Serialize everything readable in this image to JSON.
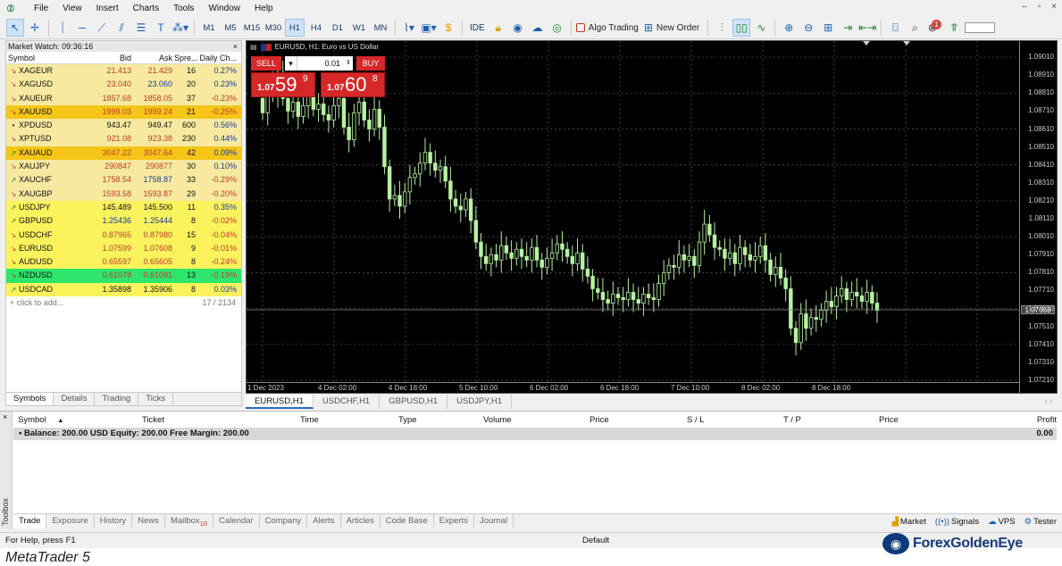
{
  "menu": {
    "items": [
      "File",
      "View",
      "Insert",
      "Charts",
      "Tools",
      "Window",
      "Help"
    ]
  },
  "toolbar": {
    "timeframes": [
      "M1",
      "M5",
      "M15",
      "M30",
      "H1",
      "H4",
      "D1",
      "W1",
      "MN"
    ],
    "active_timeframe": "H1",
    "ide_label": "IDE",
    "algo_label": "Algo Trading",
    "new_order_label": "New Order",
    "notification_count": "1"
  },
  "market_watch": {
    "title": "Market Watch: 09:36:16",
    "headers": {
      "symbol": "Symbol",
      "bid": "Bid",
      "ask": "Ask",
      "spread": "Spre...",
      "change": "Daily Ch..."
    },
    "rows": [
      {
        "symbol": "XAGEUR",
        "bid": "21.413",
        "ask": "21.429",
        "spread": "16",
        "change": "0.27%",
        "dir": "down",
        "bg": "#f7eaa0",
        "bidc": "#c0392b",
        "askc": "#c0392b",
        "chgc": "#1a3a9a"
      },
      {
        "symbol": "XAGUSD",
        "bid": "23.040",
        "ask": "23.060",
        "spread": "20",
        "change": "0.23%",
        "dir": "down",
        "bg": "#f7eaa0",
        "bidc": "#c0392b",
        "askc": "#1a3a9a",
        "chgc": "#1a3a9a"
      },
      {
        "symbol": "XAUEUR",
        "bid": "1857.68",
        "ask": "1858.05",
        "spread": "37",
        "change": "-0.23%",
        "dir": "down",
        "bg": "#f7eaa0",
        "bidc": "#c0392b",
        "askc": "#c0392b",
        "chgc": "#c0392b"
      },
      {
        "symbol": "XAUUSD",
        "bid": "1999.03",
        "ask": "1999.24",
        "spread": "21",
        "change": "-0.25%",
        "dir": "down",
        "bg": "#f5c518",
        "bidc": "#c0392b",
        "askc": "#c0392b",
        "chgc": "#c0392b"
      },
      {
        "symbol": "XPDUSD",
        "bid": "943.47",
        "ask": "949.47",
        "spread": "600",
        "change": "0.56%",
        "dir": "none",
        "bg": "#f7eaa0",
        "bidc": "#111111",
        "askc": "#111111",
        "chgc": "#1a3a9a"
      },
      {
        "symbol": "XPTUSD",
        "bid": "921.08",
        "ask": "923.38",
        "spread": "230",
        "change": "0.44%",
        "dir": "down",
        "bg": "#f7eaa0",
        "bidc": "#c0392b",
        "askc": "#c0392b",
        "chgc": "#1a3a9a"
      },
      {
        "symbol": "XAUAUD",
        "bid": "3047.22",
        "ask": "3047.64",
        "spread": "42",
        "change": "0.09%",
        "dir": "up",
        "bg": "#f5c518",
        "bidc": "#c0392b",
        "askc": "#c0392b",
        "chgc": "#1a3a9a"
      },
      {
        "symbol": "XAUJPY",
        "bid": "290847",
        "ask": "290877",
        "spread": "30",
        "change": "0.10%",
        "dir": "down",
        "bg": "#f7eaa0",
        "bidc": "#c0392b",
        "askc": "#c0392b",
        "chgc": "#1a3a9a"
      },
      {
        "symbol": "XAUCHF",
        "bid": "1758.54",
        "ask": "1758.87",
        "spread": "33",
        "change": "-0.29%",
        "dir": "up",
        "bg": "#f7eaa0",
        "bidc": "#c0392b",
        "askc": "#1a3a9a",
        "chgc": "#c0392b"
      },
      {
        "symbol": "XAUGBP",
        "bid": "1593.58",
        "ask": "1593.87",
        "spread": "29",
        "change": "-0.20%",
        "dir": "down",
        "bg": "#f7eaa0",
        "bidc": "#c0392b",
        "askc": "#c0392b",
        "chgc": "#c0392b"
      },
      {
        "symbol": "USDJPY",
        "bid": "145.489",
        "ask": "145.500",
        "spread": "11",
        "change": "0.35%",
        "dir": "up",
        "bg": "#fbf35c",
        "bidc": "#111111",
        "askc": "#111111",
        "chgc": "#1a3a9a"
      },
      {
        "symbol": "GBPUSD",
        "bid": "1.25436",
        "ask": "1.25444",
        "spread": "8",
        "change": "-0.02%",
        "dir": "up",
        "bg": "#fbf35c",
        "bidc": "#1a3a9a",
        "askc": "#1a3a9a",
        "chgc": "#c0392b"
      },
      {
        "symbol": "USDCHF",
        "bid": "0.87965",
        "ask": "0.87980",
        "spread": "15",
        "change": "-0.04%",
        "dir": "down",
        "bg": "#fbf35c",
        "bidc": "#c0392b",
        "askc": "#c0392b",
        "chgc": "#c0392b"
      },
      {
        "symbol": "EURUSD",
        "bid": "1.07599",
        "ask": "1.07608",
        "spread": "9",
        "change": "-0.01%",
        "dir": "down",
        "bg": "#fbf35c",
        "bidc": "#c0392b",
        "askc": "#c0392b",
        "chgc": "#c0392b"
      },
      {
        "symbol": "AUDUSD",
        "bid": "0.65597",
        "ask": "0.65605",
        "spread": "8",
        "change": "-0.24%",
        "dir": "down",
        "bg": "#fbf35c",
        "bidc": "#c0392b",
        "askc": "#c0392b",
        "chgc": "#c0392b"
      },
      {
        "symbol": "NZDUSD",
        "bid": "0.61078",
        "ask": "0.61091",
        "spread": "13",
        "change": "-0.19%",
        "dir": "down",
        "bg": "#2ee66b",
        "bidc": "#c0392b",
        "askc": "#c0392b",
        "chgc": "#c0392b"
      },
      {
        "symbol": "USDCAD",
        "bid": "1.35898",
        "ask": "1.35906",
        "spread": "8",
        "change": "0.03%",
        "dir": "up",
        "bg": "#fbf35c",
        "bidc": "#111111",
        "askc": "#111111",
        "chgc": "#1a3a9a"
      }
    ],
    "add_label": "click to add...",
    "count": "17 / 2134",
    "tabs": [
      "Symbols",
      "Details",
      "Trading",
      "Ticks"
    ]
  },
  "chart": {
    "title": "EURUSD, H1:  Euro vs US Dollar",
    "sell_label": "SELL",
    "buy_label": "BUY",
    "lot": "0.01",
    "sell_small": "1.07",
    "sell_big": "59",
    "sell_sup": "9",
    "buy_small": "1.07",
    "buy_big": "60",
    "buy_sup": "8",
    "current_price": "1.07603",
    "price_labels": [
      "1.09010",
      "1.08810",
      "1.08610",
      "1.08410",
      "1.08210",
      "1.08010",
      "1.07810",
      "1.07610",
      "1.07410",
      "1.07210"
    ],
    "price_labels_odd": [
      "1.08910",
      "1.08710",
      "1.08510",
      "1.08310",
      "1.08110",
      "1.07910",
      "1.07710",
      "1.07510",
      "1.07310"
    ],
    "time_labels": [
      "1 Dec 2023",
      "4 Dec 02:00",
      "4 Dec 18:00",
      "5 Dec 10:00",
      "6 Dec 02:00",
      "6 Dec 18:00",
      "7 Dec 10:00",
      "8 Dec 02:00",
      "8 Dec 18:00"
    ],
    "tabs": [
      "EURUSD,H1",
      "USDCHF,H1",
      "GBPUSD,H1",
      "USDJPY,H1"
    ]
  },
  "chart_data": {
    "type": "candlestick",
    "symbol": "EURUSD",
    "timeframe": "H1",
    "ylim": [
      1.0722,
      1.0908
    ],
    "close_series": [
      1.087,
      1.0885,
      1.088,
      1.0892,
      1.0878,
      1.0871,
      1.0876,
      1.0868,
      1.0874,
      1.088,
      1.0872,
      1.0875,
      1.0869,
      1.0866,
      1.0874,
      1.0878,
      1.0862,
      1.0855,
      1.087,
      1.0876,
      1.0866,
      1.0861,
      1.0872,
      1.0862,
      1.084,
      1.0822,
      1.0824,
      1.0818,
      1.0826,
      1.0834,
      1.0836,
      1.0842,
      1.0848,
      1.0842,
      1.0838,
      1.084,
      1.0832,
      1.0822,
      1.0818,
      1.0816,
      1.0822,
      1.081,
      1.0798,
      1.079,
      1.0786,
      1.0791,
      1.0788,
      1.0796,
      1.0792,
      1.0789,
      1.0794,
      1.079,
      1.0788,
      1.0795,
      1.0788,
      1.0784,
      1.0789,
      1.0792,
      1.0797,
      1.0794,
      1.079,
      1.0786,
      1.0792,
      1.0783,
      1.0779,
      1.0772,
      1.077,
      1.0766,
      1.0764,
      1.0769,
      1.0767,
      1.0766,
      1.077,
      1.0766,
      1.0764,
      1.0769,
      1.0767,
      1.0766,
      1.0775,
      1.0781,
      1.0785,
      1.0784,
      1.0791,
      1.0788,
      1.079,
      1.0785,
      1.0798,
      1.0808,
      1.0802,
      1.0795,
      1.0794,
      1.0789,
      1.0792,
      1.0786,
      1.0795,
      1.0791,
      1.0788,
      1.079,
      1.0796,
      1.0788,
      1.078,
      1.0784,
      1.0778,
      1.0772,
      1.075,
      1.0742,
      1.0758,
      1.075,
      1.0756,
      1.0755,
      1.076,
      1.0765,
      1.0762,
      1.0768,
      1.0772,
      1.0766,
      1.077,
      1.0768,
      1.0765,
      1.077,
      1.0764,
      1.076
    ],
    "current": 1.07603
  },
  "toolbox": {
    "vertical_label": "Toolbox",
    "headers": [
      "Symbol",
      "Ticket",
      "Time",
      "Type",
      "Volume",
      "Price",
      "S / L",
      "T / P",
      "Price",
      "Profit"
    ],
    "balance": "Balance: 200.00 USD  Equity: 200.00  Free Margin: 200.00",
    "balance_profit": "0.00",
    "tabs": [
      "Trade",
      "Exposure",
      "History",
      "News",
      "Mailbox",
      "Calendar",
      "Company",
      "Alerts",
      "Articles",
      "Code Base",
      "Experts",
      "Journal"
    ],
    "mailbox_count": "10",
    "right": [
      "Market",
      "Signals",
      "VPS",
      "Tester"
    ]
  },
  "status": {
    "help": "For Help, press F1",
    "profile": "Default"
  },
  "brand": {
    "part1": "Forex",
    "part2": "GoldenEye"
  },
  "caption": "MetaTrader 5"
}
